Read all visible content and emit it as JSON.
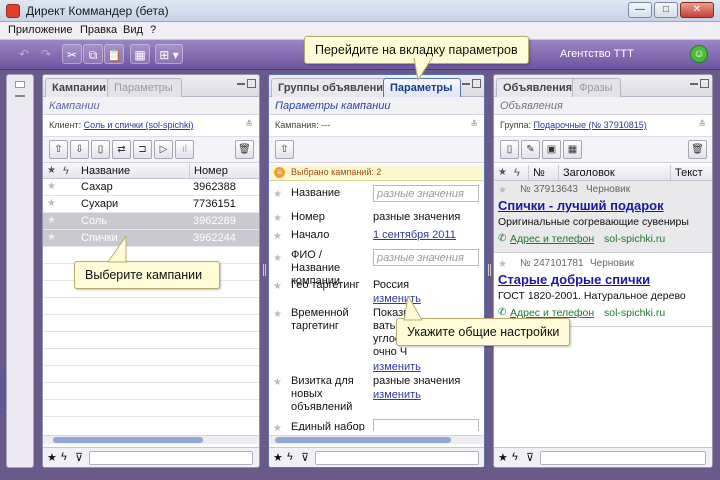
{
  "window": {
    "title": "Директ Коммандер (бета)",
    "btn_min": "—",
    "btn_max": "□",
    "btn_close": "✕"
  },
  "menu": [
    "Приложение",
    "Правка",
    "Вид",
    "?"
  ],
  "toolbar": {
    "undo": "↶",
    "redo": "↷",
    "cut": "✂",
    "copy": "⧉",
    "paste": "📋",
    "table": "▦",
    "view": "⊞ ▾",
    "agency_name": "Агентство ТТТ",
    "agency_icon": "☺"
  },
  "clients_strip": {
    "label": "Клиенты"
  },
  "campaigns_panel": {
    "tab_active": "Кампании",
    "tab_inactive": "Параметры",
    "subtitle": "Кампании",
    "filter_label": "Клиент:",
    "filter_value": "Соль и спички (sol-spichki)",
    "col_name": "Название",
    "col_number": "Номер",
    "rows": [
      {
        "name": "Сахар",
        "number": "3962388"
      },
      {
        "name": "Сухари",
        "number": "7736151"
      },
      {
        "name": "Соль",
        "number": "3962289"
      },
      {
        "name": "Спички",
        "number": "3962244"
      }
    ]
  },
  "params_panel": {
    "tab_inactive": "Группы объявлений",
    "tab_active": "Параметры",
    "subtitle": "Параметры кампании",
    "filter_label": "Кампания:",
    "filter_value": "---",
    "selected_banner": "Выбрано кампаний: 2",
    "fields": [
      {
        "label": "Название",
        "value": "разные значения",
        "kind": "input"
      },
      {
        "label": "Номер",
        "value": "разные значения",
        "kind": "text"
      },
      {
        "label": "Начало",
        "value": "1 сентября 2011",
        "kind": "link"
      },
      {
        "label": "ФИО / Название компании",
        "value": "разные значения",
        "kind": "input"
      },
      {
        "label": "Гео таргетинг",
        "value": "Россия",
        "link": "изменить"
      },
      {
        "label": "Временной таргетинг",
        "value": "Показывать круглосуточно Часовой пояс Europe/Moscow",
        "link": "изменить"
      },
      {
        "label": "Визитка для новых объявлений",
        "value": "разные значения",
        "link": "изменить"
      },
      {
        "label": "Единый набор",
        "value": "",
        "kind": "input"
      }
    ]
  },
  "ads_panel": {
    "tab_active": "Объявления",
    "tab_inactive": "Фразы",
    "subtitle": "Объявления",
    "filter_label": "Группа:",
    "filter_value": "Подарочные (№ 37910815)",
    "col_number": "№",
    "col_title": "Заголовок",
    "col_text": "Текст",
    "ads": [
      {
        "number": "№ 37913643",
        "status": "Черновик",
        "title": "Спички - лучший подарок",
        "text": "Оригинальные согревающие сувениры",
        "contact": "Адрес и телефон",
        "domain": "sol-spichki.ru"
      },
      {
        "number": "№ 247101781",
        "status": "Черновик",
        "title": "Старые добрые спички",
        "text": "ГОСТ 1820-2001. Натуральное дерево",
        "contact": "Адрес и телефон",
        "domain": "sol-spichki.ru"
      }
    ]
  },
  "callouts": {
    "tab_hint": "Перейдите на вкладку параметров",
    "select_hint": "Выберите кампании",
    "settings_hint": "Укажите общие настройки"
  }
}
